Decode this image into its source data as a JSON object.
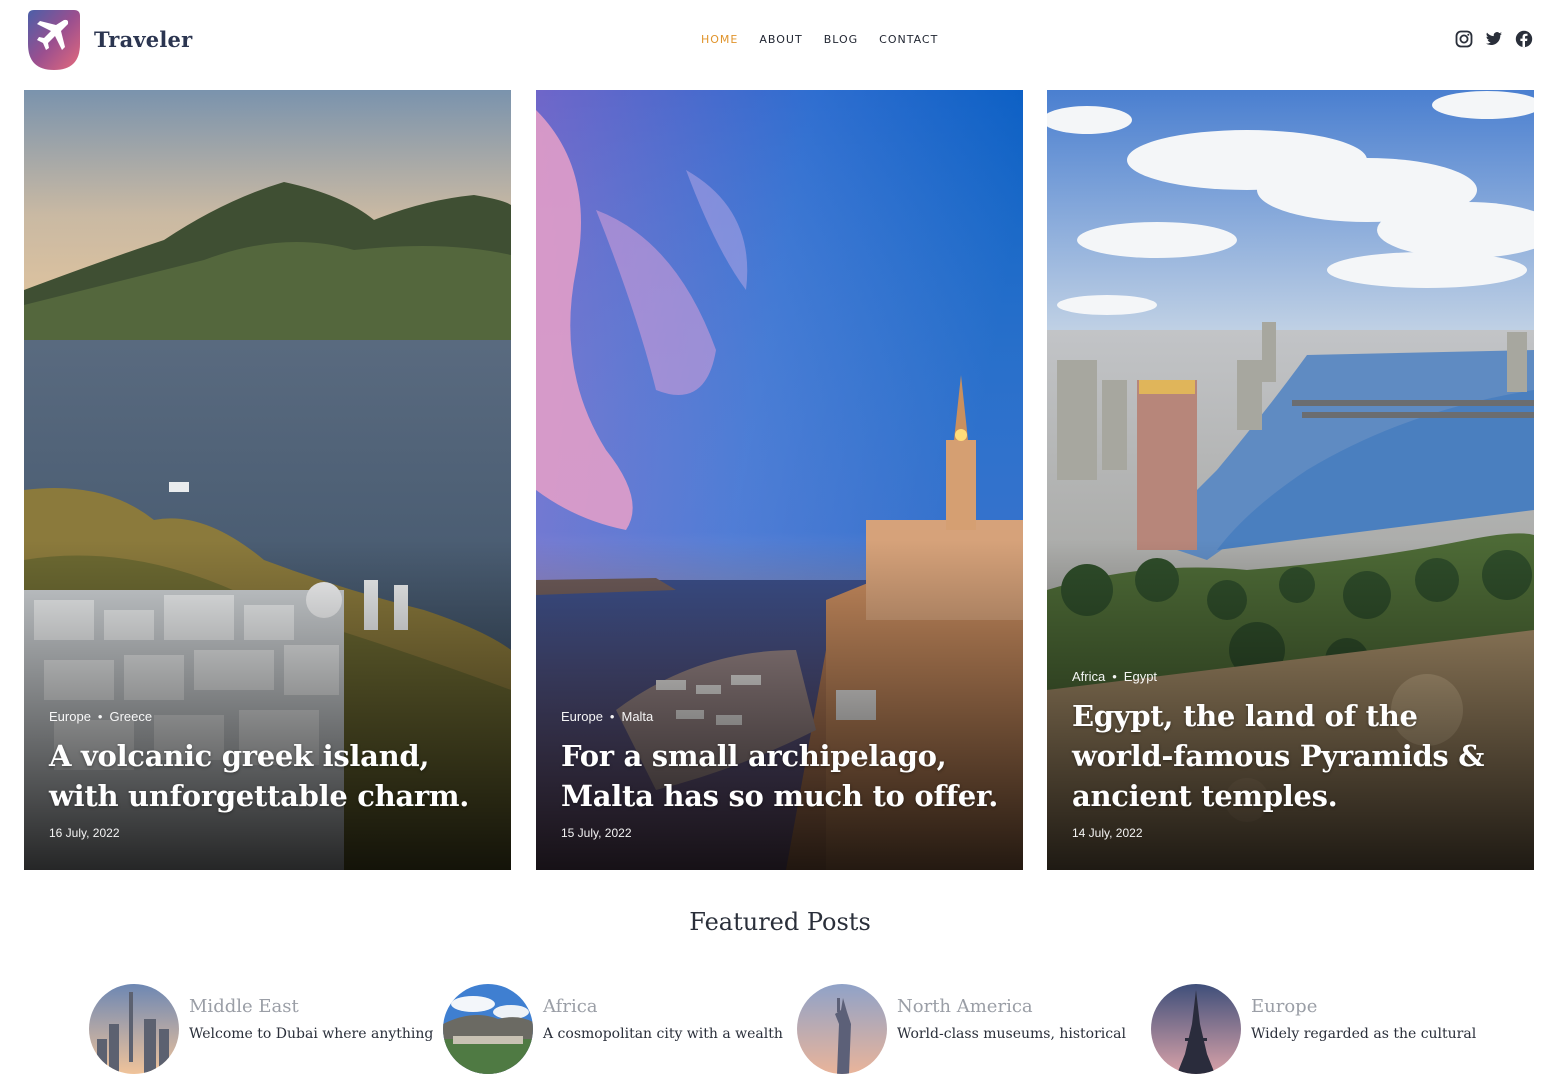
{
  "brand": {
    "name": "Traveler",
    "logo_icon": "airplane-icon"
  },
  "nav": {
    "items": [
      {
        "label": "HOME",
        "active": true
      },
      {
        "label": "ABOUT",
        "active": false
      },
      {
        "label": "BLOG",
        "active": false
      },
      {
        "label": "CONTACT",
        "active": false
      }
    ],
    "active_color": "#e0942c"
  },
  "social": [
    "instagram-icon",
    "twitter-icon",
    "facebook-icon"
  ],
  "hero_posts": [
    {
      "region": "Europe",
      "country": "Greece",
      "title": "A volcanic greek island, with unforgettable charm.",
      "date": "16 July, 2022"
    },
    {
      "region": "Europe",
      "country": "Malta",
      "title": "For a small archipelago, Malta has so much to offer.",
      "date": "15 July, 2022"
    },
    {
      "region": "Africa",
      "country": "Egypt",
      "title": "Egypt, the land of the world-famous Pyramids & ancient temples.",
      "date": "14 July, 2022"
    }
  ],
  "featured": {
    "title": "Featured Posts",
    "items": [
      {
        "region": "Middle East",
        "excerpt": "Welcome to Dubai where anything"
      },
      {
        "region": "Africa",
        "excerpt": "A cosmopolitan city with a wealth"
      },
      {
        "region": "North America",
        "excerpt": "World-class museums, historical"
      },
      {
        "region": "Europe",
        "excerpt": "Widely regarded as the cultural"
      }
    ]
  }
}
